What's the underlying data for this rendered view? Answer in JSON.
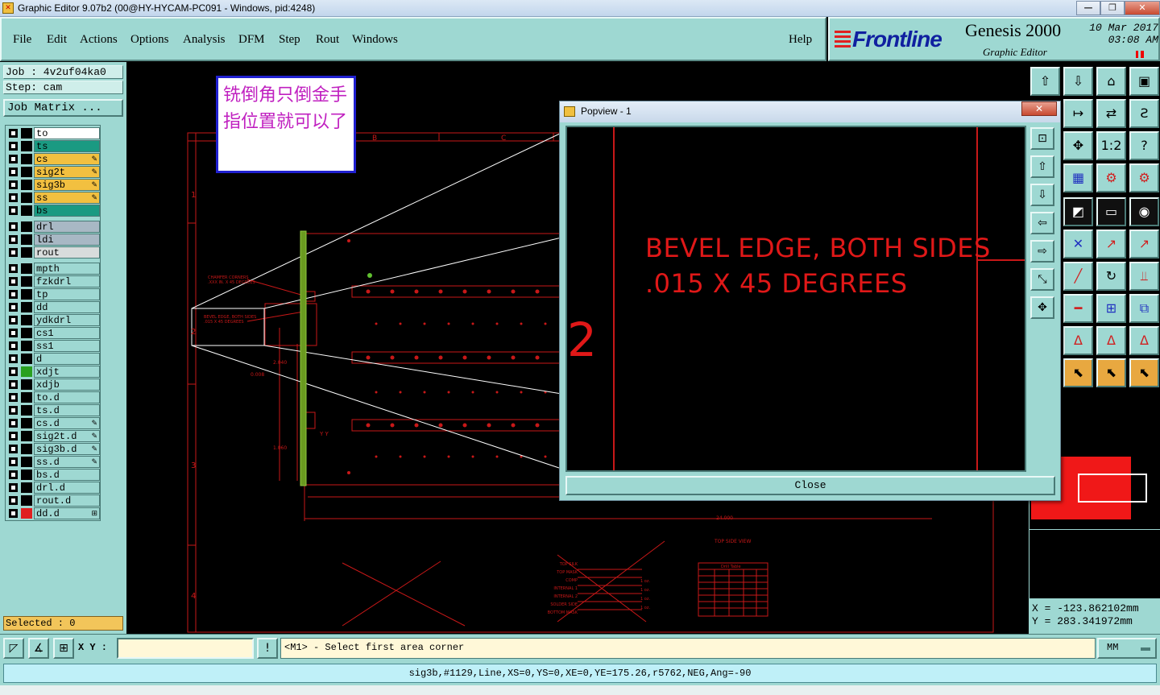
{
  "window": {
    "title": "Graphic Editor 9.07b2 (00@HY-HYCAM-PC091 - Windows, pid:4248)",
    "controls": [
      "—",
      "❐",
      "✕"
    ]
  },
  "menu": {
    "items": [
      "File",
      "Edit",
      "Actions",
      "Options",
      "Analysis",
      "DFM",
      "Step",
      "Rout",
      "Windows"
    ],
    "help": "Help"
  },
  "brand": {
    "logo": "Frontline",
    "product": "Genesis 2000",
    "subtitle": "Graphic Editor",
    "date": "10 Mar 2017",
    "time": "03:08 AM"
  },
  "left": {
    "job": "Job : 4v2uf04ka0",
    "step": "Step: cam",
    "job_matrix": "Job Matrix ...",
    "selected": "Selected : 0"
  },
  "layers": [
    {
      "name": "to",
      "color": "#ffffff",
      "swatch": "#000000",
      "mark": ""
    },
    {
      "name": "ts",
      "color": "#1a9a82",
      "swatch": "#000000",
      "mark": ""
    },
    {
      "name": "cs",
      "color": "#f2c040",
      "swatch": "#000000",
      "mark": "✎"
    },
    {
      "name": "sig2t",
      "color": "#f2c040",
      "swatch": "#000000",
      "mark": "✎"
    },
    {
      "name": "sig3b",
      "color": "#f2c040",
      "swatch": "#000000",
      "mark": "✎"
    },
    {
      "name": "ss",
      "color": "#f2c040",
      "swatch": "#000000",
      "mark": "✎"
    },
    {
      "name": "bs",
      "color": "#1a9a82",
      "swatch": "#000000",
      "mark": ""
    },
    {
      "name": "drl",
      "color": "#a8b8c4",
      "swatch": "#000000",
      "mark": ""
    },
    {
      "name": "ldi",
      "color": "#a8b8c4",
      "swatch": "#000000",
      "mark": ""
    },
    {
      "name": "rout",
      "color": "#d8dcdc",
      "swatch": "#000000",
      "mark": ""
    },
    {
      "name": "mpth",
      "color": "#9ed8d2",
      "swatch": "#000000",
      "mark": ""
    },
    {
      "name": "fzkdrl",
      "color": "#9ed8d2",
      "swatch": "#000000",
      "mark": ""
    },
    {
      "name": "tp",
      "color": "#9ed8d2",
      "swatch": "#000000",
      "mark": ""
    },
    {
      "name": "dd",
      "color": "#9ed8d2",
      "swatch": "#000000",
      "mark": ""
    },
    {
      "name": "ydkdrl",
      "color": "#9ed8d2",
      "swatch": "#000000",
      "mark": ""
    },
    {
      "name": "cs1",
      "color": "#9ed8d2",
      "swatch": "#000000",
      "mark": ""
    },
    {
      "name": "ss1",
      "color": "#9ed8d2",
      "swatch": "#000000",
      "mark": ""
    },
    {
      "name": "d",
      "color": "#9ed8d2",
      "swatch": "#000000",
      "mark": ""
    },
    {
      "name": "xdjt",
      "color": "#9ed8d2",
      "swatch": "#2aa020",
      "mark": ""
    },
    {
      "name": "xdjb",
      "color": "#9ed8d2",
      "swatch": "#000000",
      "mark": ""
    },
    {
      "name": "to.d",
      "color": "#9ed8d2",
      "swatch": "#000000",
      "mark": ""
    },
    {
      "name": "ts.d",
      "color": "#9ed8d2",
      "swatch": "#000000",
      "mark": ""
    },
    {
      "name": "cs.d",
      "color": "#9ed8d2",
      "swatch": "#000000",
      "mark": "✎"
    },
    {
      "name": "sig2t.d",
      "color": "#9ed8d2",
      "swatch": "#000000",
      "mark": "✎"
    },
    {
      "name": "sig3b.d",
      "color": "#9ed8d2",
      "swatch": "#000000",
      "mark": "✎"
    },
    {
      "name": "ss.d",
      "color": "#9ed8d2",
      "swatch": "#000000",
      "mark": "✎"
    },
    {
      "name": "bs.d",
      "color": "#9ed8d2",
      "swatch": "#000000",
      "mark": ""
    },
    {
      "name": "drl.d",
      "color": "#9ed8d2",
      "swatch": "#000000",
      "mark": ""
    },
    {
      "name": "rout.d",
      "color": "#9ed8d2",
      "swatch": "#000000",
      "mark": ""
    },
    {
      "name": "dd.d",
      "color": "#9ed8d2",
      "swatch": "#e02020",
      "mark": "⊞"
    }
  ],
  "canvas": {
    "note": "铣倒角只倒金手指位置就可以了",
    "row_labels": [
      "1",
      "2",
      "3",
      "4"
    ],
    "col_labels": [
      "B",
      "C"
    ],
    "small_texts": {
      "chamfer": "CHAMFER CORNERS",
      "chamfer2": ".XXX IN. X 45 DEGREES",
      "bevel1": "BEVEL EDGE, BOTH SIDES",
      "bevel2": ".015 X 45 DEGREES",
      "dim1": "2.040",
      "dim2": "0.008",
      "dim3": "1.060",
      "dim4": "24.000",
      "side_view": "TOP SIDE VIEW",
      "top_silk": "TOP SILK",
      "top_mask": "TOP MASK",
      "comp": "COMP",
      "internal1": "INTERNAL 1",
      "internal2": "INTERNAL 2",
      "solder_side": "SOLDER SIDE",
      "bottom_mask": "BOTTOM MASK",
      "oz1": "1 oz.",
      "oz2": "1 oz.",
      "oz3": "1 oz.",
      "oz4": "1 oz.",
      "drill_table": "Drill Table",
      "yy": "Y Y"
    }
  },
  "popview": {
    "title": "Popview - 1",
    "close_x": "✕",
    "line1": "BEVEL EDGE, BOTH SIDES",
    "line2": ".015 X 45 DEGREES",
    "big_number": "2",
    "close": "Close",
    "tools": [
      "⊡",
      "⇧",
      "⇩",
      "⇦",
      "⇨",
      "⤡",
      "✥"
    ]
  },
  "toolbox": {
    "icons": [
      {
        "glyph": "⇧",
        "name": "up-icon",
        "style": ""
      },
      {
        "glyph": "⇩",
        "name": "down-icon",
        "style": ""
      },
      {
        "glyph": "⌂",
        "name": "home-icon",
        "style": ""
      },
      {
        "glyph": "▣",
        "name": "window-icon",
        "style": ""
      },
      {
        "glyph": "↦",
        "name": "step-icon",
        "style": ""
      },
      {
        "glyph": "⇄",
        "name": "swap-icon",
        "style": ""
      },
      {
        "glyph": "Ƨ",
        "name": "snake-icon",
        "style": ""
      },
      {
        "glyph": "✥",
        "name": "pan-icon",
        "style": ""
      },
      {
        "glyph": "1:2",
        "name": "scale-icon",
        "style": ""
      },
      {
        "glyph": "?",
        "name": "help-icon",
        "style": ""
      },
      {
        "glyph": "▦",
        "name": "grid-icon",
        "style": "blue"
      },
      {
        "glyph": "⚙",
        "name": "filter-icon",
        "style": "red"
      },
      {
        "glyph": "⚙",
        "name": "filter-alt-icon",
        "style": "red"
      },
      {
        "glyph": "◩",
        "name": "color-icon",
        "style": "dark"
      },
      {
        "glyph": "▭",
        "name": "ruler-icon",
        "style": "dark"
      },
      {
        "glyph": "◉",
        "name": "snap-icon",
        "style": "dark"
      },
      {
        "glyph": "✕",
        "name": "cross-icon",
        "style": "blue"
      },
      {
        "glyph": "↗",
        "name": "pin-icon",
        "style": "red"
      },
      {
        "glyph": "↗",
        "name": "pin-alt-icon",
        "style": "red"
      },
      {
        "glyph": "╱",
        "name": "line-icon",
        "style": "red"
      },
      {
        "glyph": "↻",
        "name": "rotate-icon",
        "style": ""
      },
      {
        "glyph": "⫫",
        "name": "mirror-icon",
        "style": "red"
      },
      {
        "glyph": "━",
        "name": "split-icon",
        "style": "red"
      },
      {
        "glyph": "⊞",
        "name": "box-icon",
        "style": "blue"
      },
      {
        "glyph": "⧉",
        "name": "copy-icon",
        "style": "blue"
      },
      {
        "glyph": "Δ",
        "name": "triangle-icon",
        "style": "red"
      },
      {
        "glyph": "Δ",
        "name": "triangle-alt-icon",
        "style": "red"
      },
      {
        "glyph": "Δ",
        "name": "triangle-blue-icon",
        "style": "red"
      },
      {
        "glyph": "⬉",
        "name": "select-icon",
        "style": "orange"
      },
      {
        "glyph": "⬉",
        "name": "select-alt-icon",
        "style": "orange"
      },
      {
        "glyph": "⬉",
        "name": "select-path-icon",
        "style": "orange"
      }
    ]
  },
  "coords": {
    "x": "X = -123.862102mm",
    "y": "Y = 283.341972mm"
  },
  "bottom": {
    "xy_label": "X Y :",
    "xy_value": "",
    "prompt": "<M1> - Select first area corner",
    "units": "MM",
    "warn": "!",
    "status": "sig3b,#1129,Line,XS=0,YS=0,XE=0,YE=175.26,r5762,NEG,Ang=-90"
  }
}
